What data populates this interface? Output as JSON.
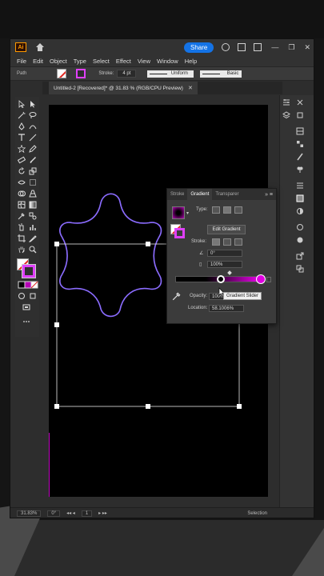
{
  "window": {
    "app_logo": "Ai",
    "share_label": "Share",
    "minimize": "—",
    "close": "✕"
  },
  "menu": [
    "File",
    "Edit",
    "Object",
    "Type",
    "Select",
    "Effect",
    "View",
    "Window",
    "Help"
  ],
  "control_bar": {
    "selection_label": "Path",
    "stroke_label": "Stroke:",
    "stroke_weight": "4 pt",
    "profile": "Uniform",
    "brush": "Basic"
  },
  "document_tab": {
    "title": "Untitled-2 [Recovered]* @ 31.83 % (RGB/CPU Preview)",
    "close": "✕"
  },
  "gradient_panel": {
    "tabs": [
      "Stroke",
      "Gradient",
      "Transparer"
    ],
    "active_tab": "Gradient",
    "menu_glyph": "»  ≡",
    "type_label": "Type:",
    "edit_button": "Edit Gradient",
    "stroke_label": "Stroke:",
    "angle_value": "0°",
    "aspect_value": "100%",
    "opacity_label": "Opacity:",
    "opacity_value": "100%",
    "location_label": "Location:",
    "location_value": "58.1006%",
    "tooltip": "Gradient Slider",
    "colors": {
      "start_stop": "#000000",
      "end_stop": "#e000e0"
    }
  },
  "status_bar": {
    "zoom": "31.83%",
    "rotation": "0°",
    "artboard_number": "1",
    "tool": "Selection"
  },
  "colors": {
    "accent": "#1473e6",
    "stroke_path": "#8b6cff",
    "canvas": "#000000"
  }
}
